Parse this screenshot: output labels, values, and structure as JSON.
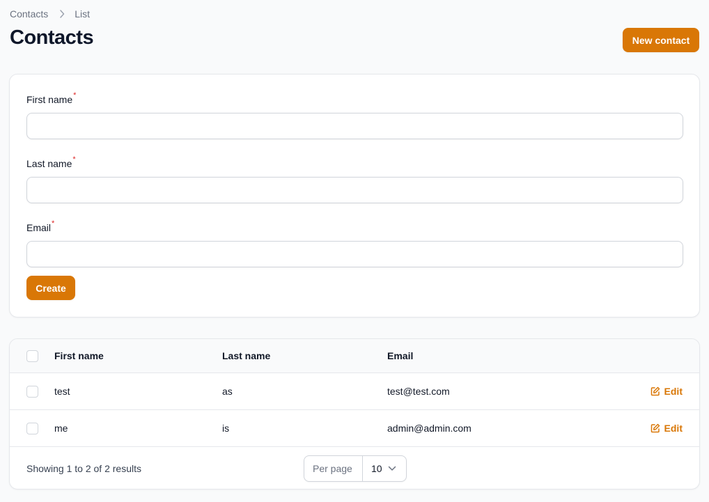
{
  "breadcrumb": {
    "items": [
      "Contacts",
      "List"
    ]
  },
  "page": {
    "title": "Contacts",
    "new_button": "New contact"
  },
  "form": {
    "fields": [
      {
        "label": "First name",
        "required_mark": "*",
        "value": ""
      },
      {
        "label": "Last name",
        "required_mark": "*",
        "value": ""
      },
      {
        "label": "Email",
        "required_mark": "*",
        "value": ""
      }
    ],
    "submit_label": "Create"
  },
  "table": {
    "columns": [
      "First name",
      "Last name",
      "Email"
    ],
    "rows": [
      {
        "first_name": "test",
        "last_name": "as",
        "email": "test@test.com",
        "action": "Edit"
      },
      {
        "first_name": "me",
        "last_name": "is",
        "email": "admin@admin.com",
        "action": "Edit"
      }
    ],
    "footer": {
      "showing": "Showing 1 to 2 of 2 results",
      "per_page_label": "Per page",
      "per_page_value": "10"
    }
  },
  "icons": {
    "breadcrumb_separator": "chevron-right-icon",
    "edit": "pencil-square-icon",
    "select": "chevron-down-icon"
  },
  "colors": {
    "accent": "#d97706",
    "required": "#dc2626",
    "background": "#f9fafb"
  }
}
